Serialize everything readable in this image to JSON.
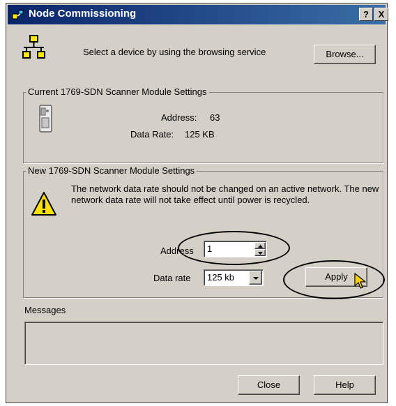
{
  "window": {
    "title": "Node Commissioning",
    "help_button": "?",
    "close_button": "X"
  },
  "browse_section": {
    "prompt": "Select a device by using the browsing service",
    "browse_label": "Browse..."
  },
  "current_settings": {
    "title": "Current 1769-SDN Scanner Module Settings",
    "address_label": "Address:",
    "address_value": "63",
    "data_rate_label": "Data Rate:",
    "data_rate_value": "125 KB"
  },
  "new_settings": {
    "title": "New 1769-SDN Scanner Module Settings",
    "warning": "The network data rate should not be changed on an active network. The new network data rate will not take effect until power is recycled.",
    "address_label": "Address",
    "address_value": "1",
    "data_rate_label": "Data rate",
    "data_rate_value": "125 kb",
    "apply_label": "Apply"
  },
  "messages": {
    "label": "Messages",
    "content": ""
  },
  "footer": {
    "close_label": "Close",
    "help_label": "Help"
  },
  "colors": {
    "dialog_face": "#d4d0c8",
    "titlebar_start": "#0a246a",
    "titlebar_end": "#3a6ea5",
    "network_icon": "#ffe800",
    "warning_icon": "#ffe000"
  },
  "icons": [
    "network-icon",
    "scanner-module-icon",
    "warning-icon",
    "spin-up-icon",
    "spin-down-icon",
    "dropdown-arrow-icon",
    "mouse-cursor-icon"
  ]
}
